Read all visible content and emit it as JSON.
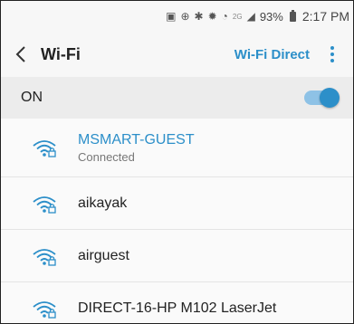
{
  "status_bar": {
    "icons": [
      "image-icon",
      "sync-icon",
      "bluetooth-icon",
      "mute-icon",
      "wifi-signal-icon",
      "4g-icon",
      "cell-signal-icon"
    ],
    "network_type": "2G",
    "battery": "93%",
    "time": "2:17 PM"
  },
  "app_bar": {
    "title": "Wi-Fi",
    "action": "Wi-Fi Direct"
  },
  "toggle": {
    "label": "ON",
    "state": "on"
  },
  "networks": [
    {
      "name": "MSMART-GUEST",
      "status": "Connected",
      "secured": true
    },
    {
      "name": "aikayak",
      "secured": true
    },
    {
      "name": "airguest",
      "secured": true
    },
    {
      "name": "DIRECT-16-HP M102 LaserJet",
      "secured": true
    }
  ],
  "colors": {
    "accent": "#2c8fc9",
    "header_bg": "#f7f7f7",
    "toggle_row_bg": "#ececec",
    "text": "#222222",
    "subtext": "#777777"
  }
}
